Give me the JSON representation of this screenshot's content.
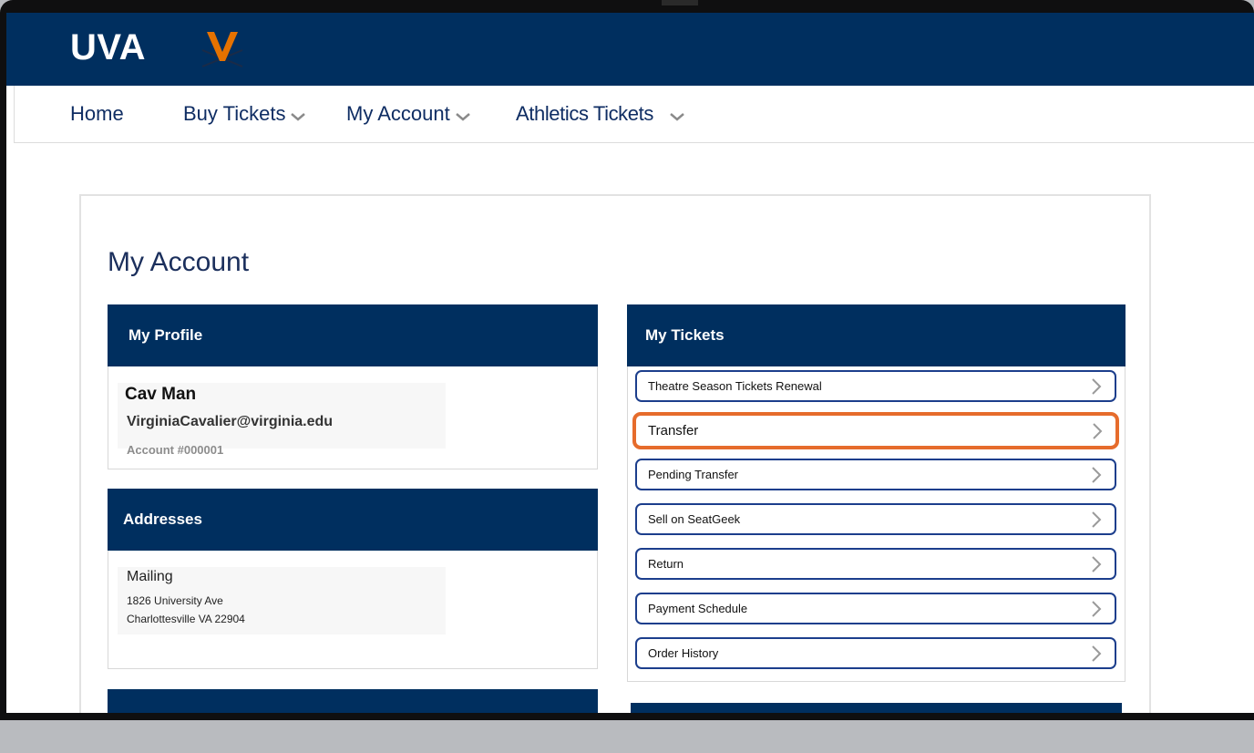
{
  "header": {
    "logo_text": "UVA",
    "brand_colors": {
      "navy": "#002f5f",
      "orange": "#e66c2c"
    }
  },
  "nav": {
    "items": [
      {
        "label": "Home",
        "has_dropdown": false
      },
      {
        "label": "Buy Tickets",
        "has_dropdown": true
      },
      {
        "label": "My Account",
        "has_dropdown": true
      },
      {
        "label": "Athletics Tickets",
        "has_dropdown": true
      }
    ]
  },
  "page": {
    "title": "My Account"
  },
  "profile": {
    "heading": "My Profile",
    "name": "Cav Man",
    "email": "VirginiaCavalier@virginia.edu",
    "account": "Account #000001"
  },
  "addresses": {
    "heading": "Addresses",
    "type": "Mailing",
    "line1": "1826 University Ave",
    "line2": "Charlottesville VA 22904"
  },
  "tickets": {
    "heading": "My Tickets",
    "items": [
      {
        "label": "Theatre Season Tickets Renewal",
        "highlighted": false
      },
      {
        "label": "Transfer",
        "highlighted": true
      },
      {
        "label": "Pending Transfer",
        "highlighted": false
      },
      {
        "label": "Sell on SeatGeek",
        "highlighted": false
      },
      {
        "label": "Return",
        "highlighted": false
      },
      {
        "label": "Payment Schedule",
        "highlighted": false
      },
      {
        "label": "Order History",
        "highlighted": false
      }
    ]
  },
  "icons": {
    "logo": "uva-v-sabres-logo-icon",
    "dropdown": "chevron-down-icon",
    "row_arrow": "chevron-right-icon"
  }
}
